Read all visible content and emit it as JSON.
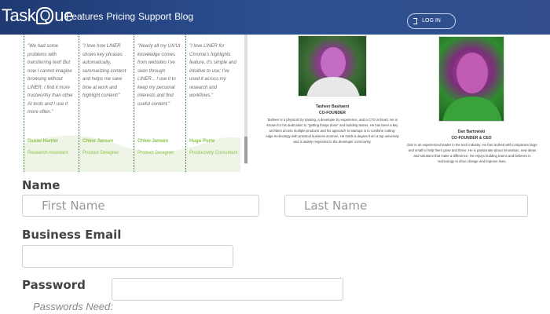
{
  "header": {
    "logo_left": "Task",
    "logo_q": "Q",
    "logo_right": "ue",
    "nav": [
      "Features",
      "Pricing",
      "Support",
      "Blog"
    ],
    "login_label": "LOG IN"
  },
  "testimonials": [
    {
      "quote": "\"We had some problems with transferring text! But now I cannot imagine browsing without LINER. I find it more trustworthy than other AI tools and I use it more often.\"",
      "name": "Daniel Hunter",
      "role": "Research Assistant"
    },
    {
      "quote": "\"I love how LINER shows key phrases automatically, summarizing content and helps me save time at work and highlight content!\"",
      "name": "Chloe Jansen",
      "role": "Product Designer"
    },
    {
      "quote": "\"Nearly all my UX/UI knowledge comes from websites I've seen through LINER... I use it to keep my personal interests and find useful content.\"",
      "name": "Chloe Jansen",
      "role": "Product Designer"
    },
    {
      "quote": "\"I love LINER for Chrome's highlights feature, it's simple and intuitive to use; I've used it across my research and workflows.\"",
      "name": "Hugo Porte",
      "role": "Productivity Consultant"
    }
  ],
  "founders": [
    {
      "name": "Tasheer Bashaeni",
      "title": "CO-FOUNDER",
      "bio": "Tasheer is a physicist by training, a developer by experience, and a CTO at heart. He is known for his dedication to \"getting things done\" and building teams. He has been a key architect across multiple products and his approach to startups is to combine cutting-edge technology with practical business acumen. He holds a degree from a top university and is widely respected in the developer community."
    },
    {
      "name": "Dan Bartowski",
      "title": "CO-FOUNDER & CEO",
      "bio": "Dan is an experienced leader in the tech industry. He has worked with companies large and small to help them grow and thrive. He is passionate about innovation, new ideas and solutions that make a difference. He enjoys building teams and believes in technology to drive change and improve lives."
    }
  ],
  "form": {
    "name_label": "Name",
    "first_name_placeholder": "First Name",
    "last_name_placeholder": "Last Name",
    "email_label": "Business Email",
    "email_value": "",
    "password_label": "Password",
    "password_value": "",
    "passwords_need": "Passwords Need:"
  },
  "colors": {
    "header": "#2c4f92",
    "testimonial_accent": "#8bc34a",
    "divider": "#2e7d32"
  }
}
